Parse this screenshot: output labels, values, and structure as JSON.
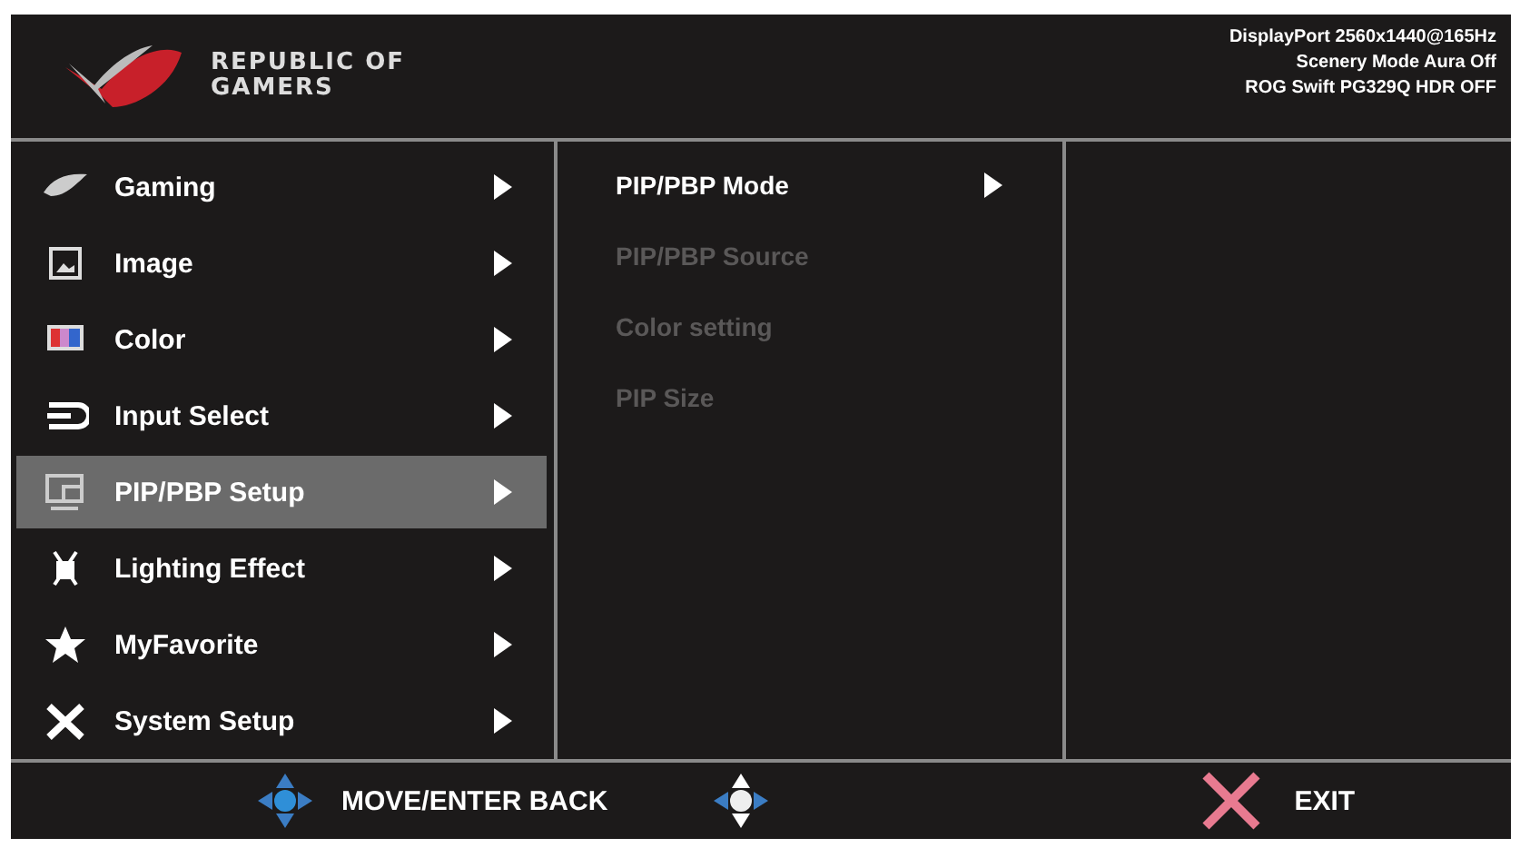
{
  "header": {
    "logo_text": [
      "REPUBLIC OF",
      "GAMERS"
    ],
    "status": [
      "DisplayPort 2560x1440@165Hz",
      "Scenery Mode Aura Off",
      "ROG Swift PG329Q HDR OFF"
    ]
  },
  "menu": [
    {
      "kind": "gaming",
      "label": "Gaming",
      "selected": false
    },
    {
      "kind": "image",
      "label": "Image",
      "selected": false
    },
    {
      "kind": "color",
      "label": "Color",
      "selected": false
    },
    {
      "kind": "input",
      "label": "Input Select",
      "selected": false
    },
    {
      "kind": "pip",
      "label": "PIP/PBP Setup",
      "selected": true
    },
    {
      "kind": "lighting",
      "label": "Lighting Effect",
      "selected": false
    },
    {
      "kind": "favorite",
      "label": "MyFavorite",
      "selected": false
    },
    {
      "kind": "system",
      "label": "System Setup",
      "selected": false
    }
  ],
  "submenu": [
    {
      "label": "PIP/PBP Mode",
      "disabled": false,
      "arrow": true
    },
    {
      "label": "PIP/PBP Source",
      "disabled": true,
      "arrow": false
    },
    {
      "label": "Color setting",
      "disabled": true,
      "arrow": false
    },
    {
      "label": "PIP Size",
      "disabled": true,
      "arrow": false
    }
  ],
  "footer": [
    {
      "kind": "move",
      "label": "MOVE/ENTER BACK"
    },
    {
      "kind": "back"
    },
    {
      "kind": "exit",
      "label": "EXIT"
    }
  ]
}
